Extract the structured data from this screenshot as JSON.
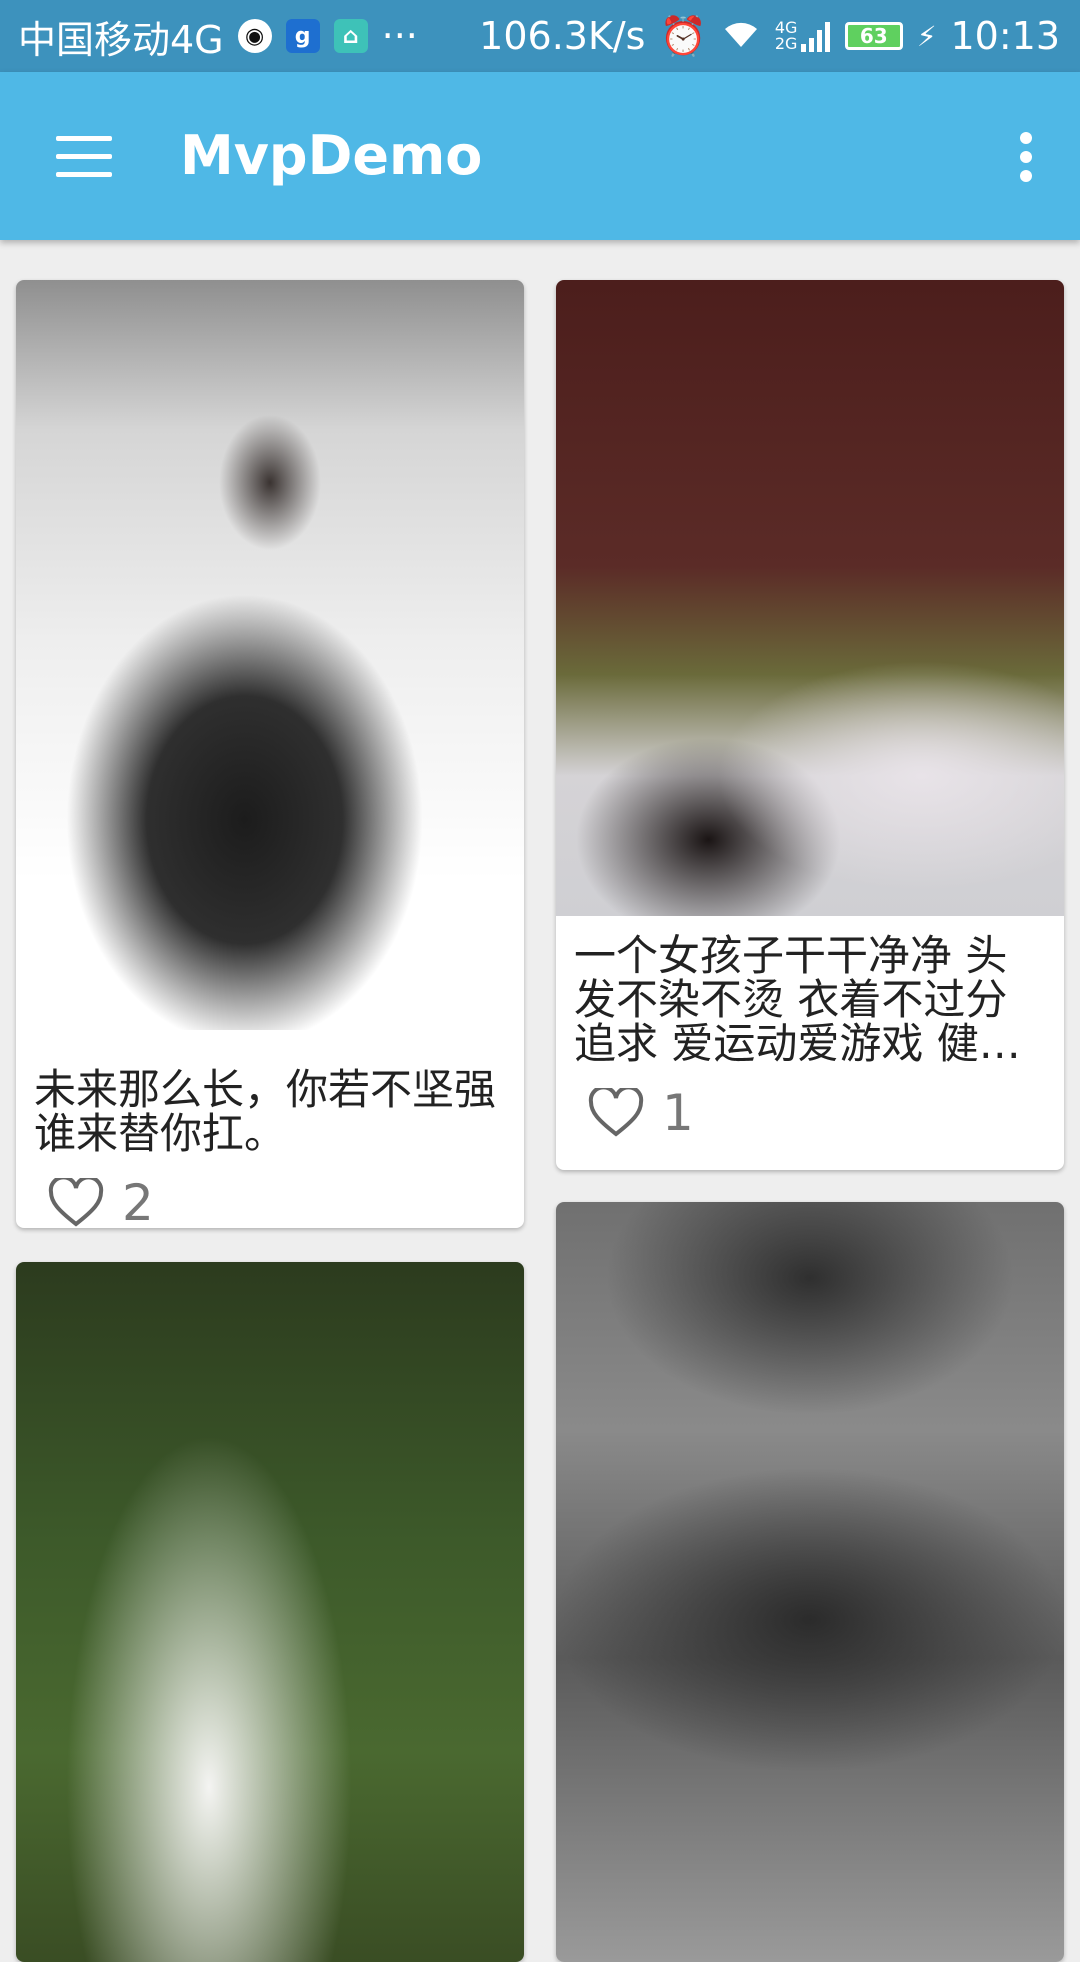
{
  "status_bar": {
    "carrier": "中国移动4G",
    "more": "···",
    "speed": "106.3K/s",
    "network": "4G 2G",
    "battery": "63",
    "time": "10:13"
  },
  "app_bar": {
    "title": "MvpDemo",
    "color": "#4fb8e6"
  },
  "feed": [
    {
      "caption": "未来那么长，你若不坚强谁来替你扛。",
      "likes": "2",
      "image": "sketch-dress-illustration"
    },
    {
      "caption": "一个女孩子干干净净 头发不染不烫 衣着不过分追求 爱运动爱游戏 健…",
      "likes": "1",
      "image": "woman-lying-with-flower"
    },
    {
      "caption": "",
      "likes": "",
      "image": "woman-in-white-forest"
    },
    {
      "caption": "",
      "likes": "",
      "image": "black-white-lips"
    }
  ]
}
